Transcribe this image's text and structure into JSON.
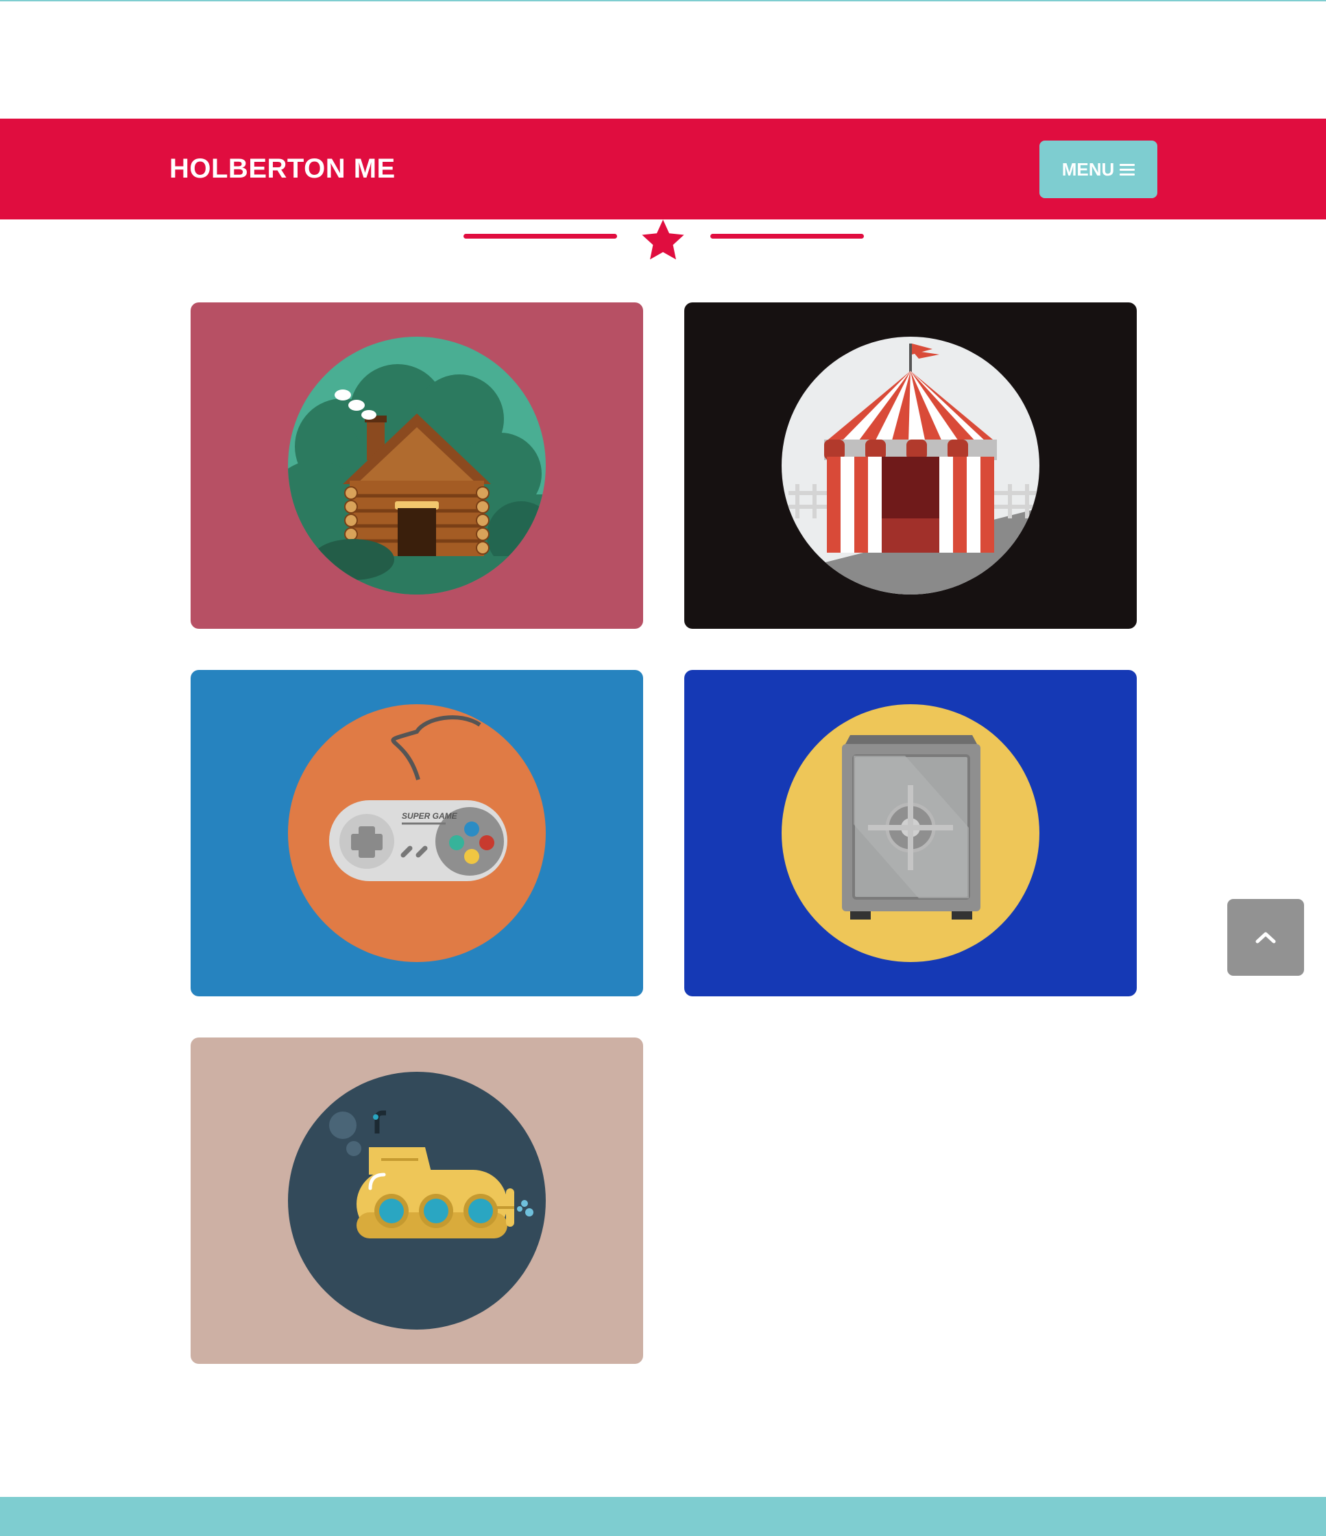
{
  "header": {
    "brand": "HOLBERTON ME",
    "menu_label": "MENU",
    "background_color": "#e00d3f",
    "menu_color": "#7ecdd0"
  },
  "divider": {
    "icon": "star-icon",
    "color": "#e00d3f"
  },
  "portfolio": {
    "items": [
      {
        "icon": "log-cabin-icon",
        "background": "#b75064"
      },
      {
        "icon": "circus-tent-icon",
        "background": "#161111"
      },
      {
        "icon": "game-controller-icon",
        "background": "#2683bf",
        "text": "SUPER GAME"
      },
      {
        "icon": "safe-icon",
        "background": "#1539b5"
      },
      {
        "icon": "submarine-icon",
        "background": "#cdb0a4"
      }
    ]
  },
  "back_to_top": {
    "icon": "chevron-up-icon"
  },
  "footer": {
    "color": "#7ecdd0"
  }
}
